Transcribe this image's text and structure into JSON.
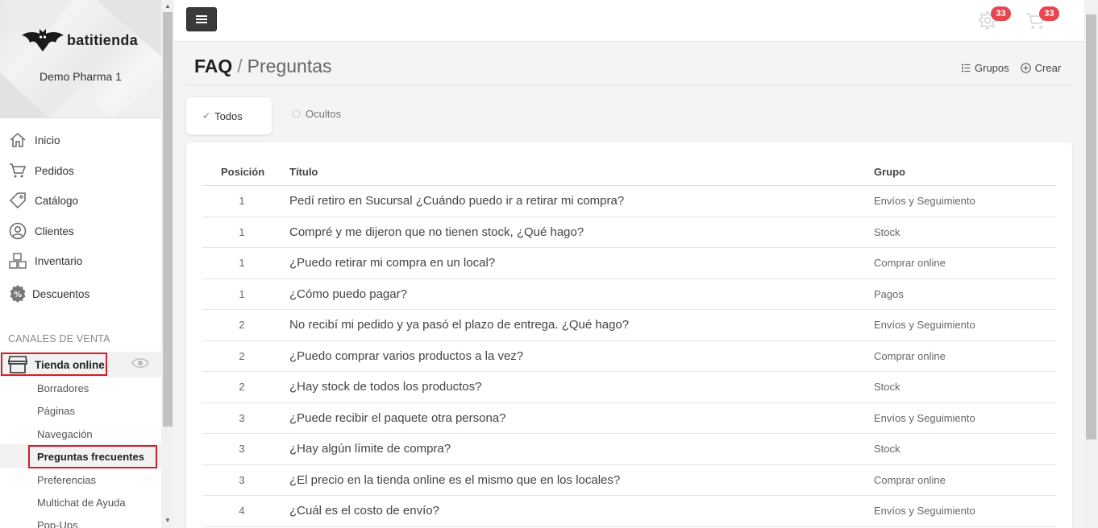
{
  "brand": {
    "logo_text": "batitienda",
    "store_name": "Demo Pharma 1"
  },
  "nav": [
    {
      "label": "Inicio",
      "icon": "home-icon"
    },
    {
      "label": "Pedidos",
      "icon": "cart-icon"
    },
    {
      "label": "Catálogo",
      "icon": "tag-icon"
    },
    {
      "label": "Clientes",
      "icon": "user-icon"
    },
    {
      "label": "Inventario",
      "icon": "boxes-icon"
    },
    {
      "label": "Descuentos",
      "icon": "discount-icon"
    }
  ],
  "channels": {
    "title": "CANALES DE VENTA",
    "store_label": "Tienda online",
    "sub_items": [
      "Borradores",
      "Páginas",
      "Navegación",
      "Preguntas frecuentes",
      "Preferencias",
      "Multichat de Ayuda",
      "Pop-Ups"
    ]
  },
  "topbar": {
    "settings_badge": "33",
    "cart_badge": "33"
  },
  "header": {
    "title": "FAQ",
    "separator": "/",
    "subtitle": "Preguntas",
    "groups_label": "Grupos",
    "create_label": "Crear"
  },
  "tabs": {
    "all": "Todos",
    "hidden": "Ocultos"
  },
  "table": {
    "headers": {
      "position": "Posición",
      "title": "Título",
      "group": "Grupo"
    },
    "rows": [
      {
        "position": "1",
        "title": "Pedí retiro en Sucursal ¿Cuándo puedo ir a retirar mi compra?",
        "group": "Envíos y Seguimiento"
      },
      {
        "position": "1",
        "title": "Compré y me dijeron que no tienen stock, ¿Qué hago?",
        "group": "Stock"
      },
      {
        "position": "1",
        "title": "¿Puedo retirar mi compra en un local?",
        "group": "Comprar online"
      },
      {
        "position": "1",
        "title": "¿Cómo puedo pagar?",
        "group": "Pagos"
      },
      {
        "position": "2",
        "title": "No recibí mi pedido y ya pasó el plazo de entrega. ¿Qué hago?",
        "group": "Envíos y Seguimiento"
      },
      {
        "position": "2",
        "title": "¿Puedo comprar varios productos a la vez?",
        "group": "Comprar online"
      },
      {
        "position": "2",
        "title": "¿Hay stock de todos los productos?",
        "group": "Stock"
      },
      {
        "position": "3",
        "title": "¿Puede recibir el paquete otra persona?",
        "group": "Envíos y Seguimiento"
      },
      {
        "position": "3",
        "title": "¿Hay algún límite de compra?",
        "group": "Stock"
      },
      {
        "position": "3",
        "title": "¿El precio en la tienda online es el mismo que en los locales?",
        "group": "Comprar online"
      },
      {
        "position": "4",
        "title": "¿Cuál es el costo de envío?",
        "group": "Envíos y Seguimiento"
      }
    ]
  },
  "colors": {
    "accent_badge": "#e8464f",
    "highlight_border": "#d0202b",
    "menu_button": "#3a3a3a"
  }
}
